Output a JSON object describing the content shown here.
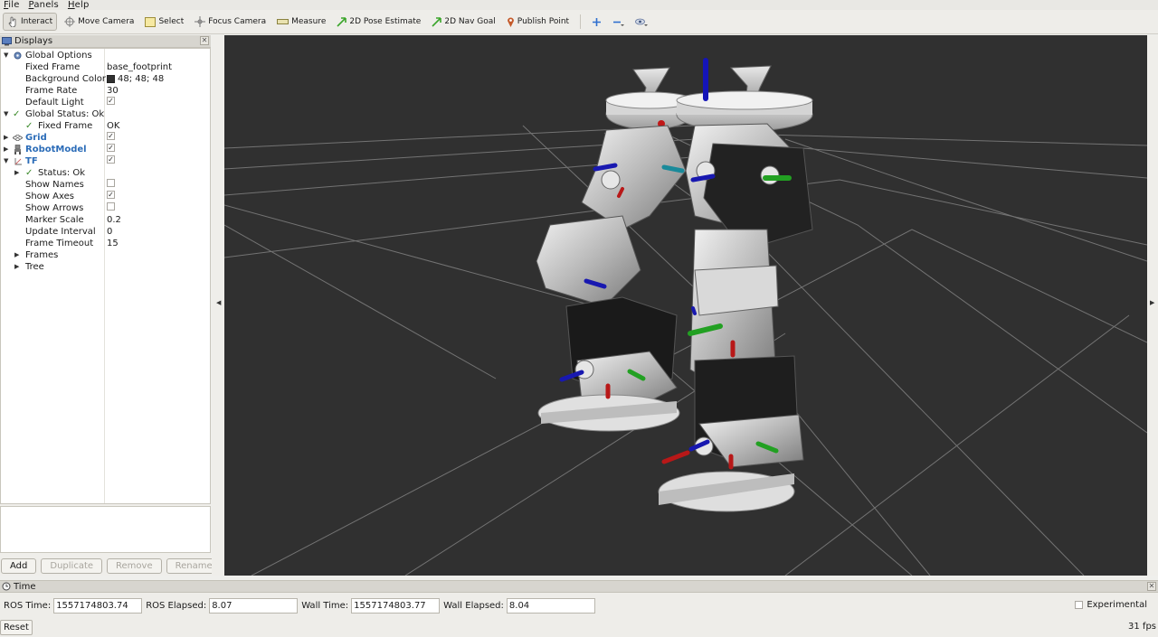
{
  "menu": [
    "File",
    "Panels",
    "Help"
  ],
  "toolbar": {
    "interact": "Interact",
    "move_camera": "Move Camera",
    "select": "Select",
    "focus_camera": "Focus Camera",
    "measure": "Measure",
    "pose_estimate": "2D Pose Estimate",
    "nav_goal": "2D Nav Goal",
    "publish_point": "Publish Point"
  },
  "displays": {
    "title": "Displays",
    "rows": {
      "global_options": "Global Options",
      "fixed_frame_label": "Fixed Frame",
      "fixed_frame_value": "base_footprint",
      "background_color_label": "Background Color",
      "background_color_value": "48; 48; 48",
      "frame_rate_label": "Frame Rate",
      "frame_rate_value": "30",
      "default_light_label": "Default Light",
      "global_status": "Global Status: Ok",
      "status_fixed_frame": "Fixed Frame",
      "status_fixed_frame_value": "OK",
      "grid": "Grid",
      "robot_model": "RobotModel",
      "tf": "TF",
      "tf_status": "Status: Ok",
      "show_names": "Show Names",
      "show_axes": "Show Axes",
      "show_arrows": "Show Arrows",
      "marker_scale_label": "Marker Scale",
      "marker_scale_value": "0.2",
      "update_interval_label": "Update Interval",
      "update_interval_value": "0",
      "frame_timeout_label": "Frame Timeout",
      "frame_timeout_value": "15",
      "frames": "Frames",
      "tree": "Tree"
    },
    "buttons": {
      "add": "Add",
      "duplicate": "Duplicate",
      "remove": "Remove",
      "rename": "Rename"
    }
  },
  "time": {
    "title": "Time",
    "ros_time_label": "ROS Time:",
    "ros_time_value": "1557174803.74",
    "ros_elapsed_label": "ROS Elapsed:",
    "ros_elapsed_value": "8.07",
    "wall_time_label": "Wall Time:",
    "wall_time_value": "1557174803.77",
    "wall_elapsed_label": "Wall Elapsed:",
    "wall_elapsed_value": "8.04",
    "experimental": "Experimental",
    "reset": "Reset",
    "fps": "31 fps"
  },
  "colors": {
    "viewport_bg": "#303030",
    "accent_blue": "#2b6cb8",
    "ok_green": "#3b8a2a"
  }
}
